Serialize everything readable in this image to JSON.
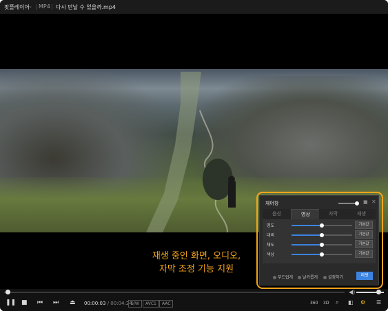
{
  "titlebar": {
    "app_name": "팟플레이어",
    "chevron": "⌄",
    "format": "MP4",
    "filename": "다시 만날 수 있을까.mp4"
  },
  "caption": {
    "line1": "재생 중인 화면, 오디오,",
    "line2": "자막 조정 기능 지원"
  },
  "panel": {
    "title": "재어창",
    "pin_icon": "■",
    "close_icon": "✕",
    "tabs": [
      {
        "label": "음성",
        "active": false
      },
      {
        "label": "영상",
        "active": true
      },
      {
        "label": "자막",
        "active": false
      },
      {
        "label": "재생",
        "active": false
      }
    ],
    "rows": [
      {
        "label": "명도",
        "value": 0.5,
        "button": "기본값"
      },
      {
        "label": "대비",
        "value": 0.5,
        "button": "기본값"
      },
      {
        "label": "채도",
        "value": 0.5,
        "button": "기본값"
      },
      {
        "label": "색상",
        "value": 0.5,
        "button": "기본값"
      }
    ],
    "options": [
      "부드럽게",
      "날카롭게",
      "설정하기"
    ],
    "reset_label": "리셋",
    "accent_color": "#3c83e0"
  },
  "player": {
    "progress": 0.01,
    "volume": 0.8,
    "current_time": "00:00:03",
    "separator": "/",
    "duration": "00:04:24",
    "tags": [
      "S/W",
      "AVC1",
      "AAC"
    ],
    "right_icons": [
      "360",
      "3D",
      "⌕",
      "◧",
      "⚙",
      "☰"
    ]
  },
  "highlight_color": "#f4a51c"
}
